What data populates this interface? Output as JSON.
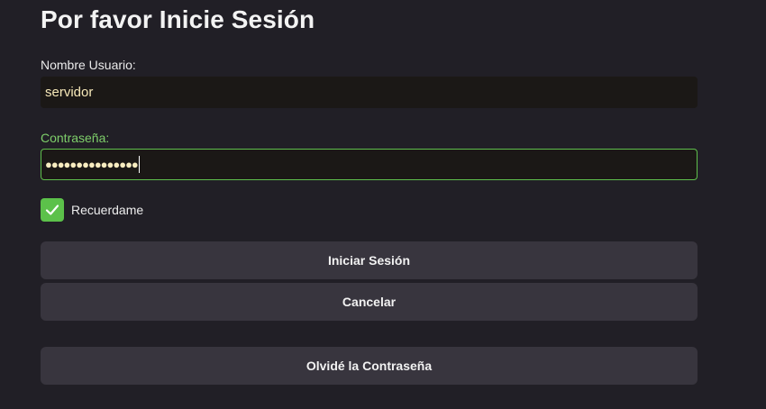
{
  "login": {
    "title": "Por favor Inicie Sesión",
    "username_label": "Nombre Usuario:",
    "username_value": "servidor",
    "password_label": "Contraseña:",
    "password_mask": "●●●●●●●●●●●●●●●",
    "remember_label": "Recuerdame",
    "remember_checked": true,
    "login_button": "Iniciar Sesión",
    "cancel_button": "Cancelar",
    "forgot_button": "Olvidé la Contraseña"
  },
  "colors": {
    "background": "#211f26",
    "accent": "#5cc14a",
    "button": "#38353e",
    "field": "#1b1816"
  },
  "icons": {
    "checkbox": "checkmark-icon"
  }
}
